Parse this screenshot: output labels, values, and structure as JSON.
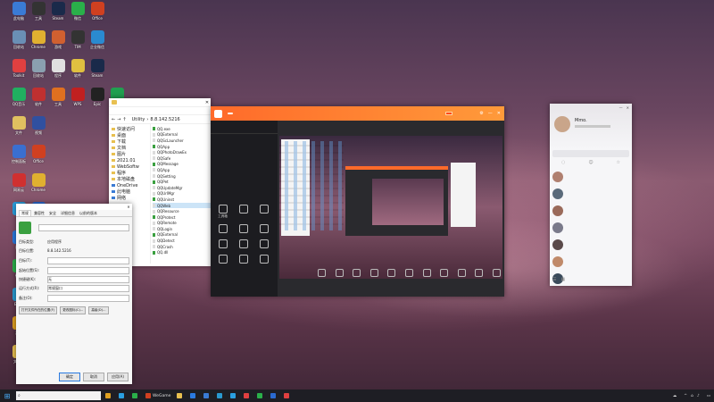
{
  "desktop": {
    "icons": [
      {
        "label": "此电脑",
        "color": "#3a7bd5"
      },
      {
        "label": "回收站",
        "color": "#6a8fb5"
      },
      {
        "label": "Toolkit",
        "color": "#e04040"
      },
      {
        "label": "QQ音乐",
        "color": "#20b060"
      },
      {
        "label": "文件",
        "color": "#e0c060"
      },
      {
        "label": "控制面板",
        "color": "#3a6fd0"
      },
      {
        "label": "网易云",
        "color": "#d03030"
      },
      {
        "label": "QQ",
        "color": "#2aa0e0"
      },
      {
        "label": "迅雷",
        "color": "#2a7ae0"
      },
      {
        "label": "微信",
        "color": "#2ab04a"
      },
      {
        "label": "Edge",
        "color": "#2a9ad0"
      },
      {
        "label": "游戏",
        "color": "#e0a020"
      },
      {
        "label": "文件夹",
        "color": "#e8c050"
      },
      {
        "label": "工具",
        "color": "#333"
      },
      {
        "label": "Chrome",
        "color": "#e0b030"
      },
      {
        "label": "回收站",
        "color": "#8aa0b0"
      },
      {
        "label": "软件",
        "color": "#c03030"
      },
      {
        "label": "视频",
        "color": "#3050a0"
      },
      {
        "label": "Office",
        "color": "#d04020"
      },
      {
        "label": "Chrome",
        "color": "#e0b030"
      },
      {
        "label": "腾讯会议",
        "color": "#2a6ad0"
      },
      {
        "label": "Steam",
        "color": "#1a2a4a"
      },
      {
        "label": "游戏",
        "color": "#d06030"
      },
      {
        "label": "程序",
        "color": "#e0e0e0"
      },
      {
        "label": "工具",
        "color": "#e07020"
      },
      {
        "label": "微信",
        "color": "#2ab04a"
      },
      {
        "label": "TIM",
        "color": "#333"
      },
      {
        "label": "软件",
        "color": "#e0c040"
      },
      {
        "label": "WPS",
        "color": "#c02020"
      },
      {
        "label": "Office",
        "color": "#d04020"
      },
      {
        "label": "企业微信",
        "color": "#2a8ad0"
      },
      {
        "label": "Steam",
        "color": "#1a2a4a"
      },
      {
        "label": "Epic",
        "color": "#222"
      },
      {
        "label": "iQIYI",
        "color": "#20a050"
      },
      {
        "label": "设置",
        "color": "#6a6a6a"
      },
      {
        "label": "爱奇艺",
        "color": "#20b040"
      },
      {
        "label": "Edge",
        "color": "#2a9ad0"
      }
    ]
  },
  "file_explorer": {
    "path": [
      "Utility",
      "8.8.142.5216"
    ],
    "sidebar": [
      "快速访问",
      "桌面",
      "下载",
      "文档",
      "图片",
      "2021.01",
      "WebSoftw",
      "程序",
      "本地磁盘",
      "OneDrive",
      "此电脑",
      "网络"
    ],
    "files": [
      "QQ.exe",
      "QQExternal",
      "QQScLauncher",
      "QQApp",
      "QQPhotoDrawEx",
      "QQSafe",
      "QQMessage",
      "QQApp",
      "QQSetting",
      "QQPet",
      "QQUpdateMgr",
      "QQUrlMgr",
      "QQUninst",
      "QQWeb",
      "QQResource",
      "QQProtect",
      "QQRemote",
      "QQLogin",
      "QQExternal",
      "QQDetect",
      "QQCrash",
      "QQ.dll"
    ],
    "status_left": "",
    "status_right": ""
  },
  "properties_dialog": {
    "tabs": [
      "常规",
      "兼容性",
      "安全",
      "详细信息",
      "以前的版本"
    ],
    "icon_name": "app-icon",
    "fields": [
      {
        "label": "目标类型:",
        "value": "应用程序"
      },
      {
        "label": "目标位置:",
        "value": "8.8.142.5216"
      },
      {
        "label": "目标(T):",
        "value": ""
      },
      {
        "label": "起始位置(S):",
        "value": ""
      },
      {
        "label": "快捷键(K):",
        "value": "无"
      },
      {
        "label": "运行方式(R):",
        "value": "常规窗口"
      },
      {
        "label": "备注(O):",
        "value": ""
      }
    ],
    "buttons": [
      "打开文件所在的位置(F)",
      "更改图标(C)...",
      "高级(D)..."
    ],
    "footer": [
      "确定",
      "取消",
      "应用(A)"
    ]
  },
  "phone_assistant": {
    "title": "",
    "tab": "",
    "left_tools": [
      "工具箱",
      "",
      "",
      "",
      "",
      "",
      "",
      "",
      "",
      "",
      "",
      ""
    ],
    "bottom_tools": [
      "",
      "",
      "",
      "",
      "",
      "",
      "",
      "",
      "",
      "",
      ""
    ]
  },
  "chat_window": {
    "name": "Mmo.",
    "contacts": [
      {
        "name": "",
        "msg": "",
        "color": "#b08070"
      },
      {
        "name": "",
        "msg": "",
        "color": "#5a6a7a"
      },
      {
        "name": "",
        "msg": "",
        "color": "#9a6a5a"
      },
      {
        "name": "",
        "msg": "",
        "color": "#7a7a8a"
      },
      {
        "name": "",
        "msg": "",
        "color": "#5a4a4a"
      },
      {
        "name": "",
        "msg": "",
        "color": "#c08a6a"
      },
      {
        "name": "",
        "msg": "",
        "color": "#3a4a5a"
      }
    ]
  },
  "taskbar": {
    "search_placeholder": "",
    "items": [
      {
        "label": "",
        "color": "#e0a020"
      },
      {
        "label": "",
        "color": "#2aa0e0"
      },
      {
        "label": "",
        "color": "#2ab04a"
      },
      {
        "label": "WeGame",
        "color": "#d04020"
      },
      {
        "label": "",
        "color": "#e8c050"
      },
      {
        "label": "",
        "color": "#2a7ae0"
      },
      {
        "label": "",
        "color": "#3a7bd5"
      },
      {
        "label": "",
        "color": "#2a9ad0"
      },
      {
        "label": "",
        "color": "#2aa0e0"
      },
      {
        "label": "",
        "color": "#e04040"
      },
      {
        "label": "",
        "color": "#2ab04a"
      },
      {
        "label": "",
        "color": "#2a6ad0"
      },
      {
        "label": "",
        "color": "#e04040"
      }
    ],
    "tray": {
      "temp": "",
      "time": "",
      "date": ""
    }
  }
}
